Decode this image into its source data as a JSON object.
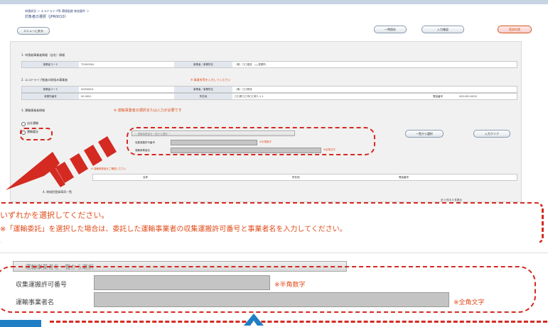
{
  "breadcrumb": {
    "line1": "申請状況 ＞ エコドライブ等 環境配慮 参加要件 ＞",
    "line2": "対象者の選択（JPR0010）"
  },
  "toolbar": {
    "back_label": "メニューに戻る",
    "temp_save_label": "一時保存",
    "check_label": "入力確認",
    "register_label": "登録申請"
  },
  "section1": {
    "heading": "1. 申請者事業者情報（自社）情報",
    "row": [
      {
        "label": "事業者コード",
        "value": "TO000004"
      },
      {
        "label": "事業者／事業所名",
        "value": "（株）〇〇運送　△△営業所"
      }
    ]
  },
  "section2": {
    "heading": "2. エコドライブ推進の取組み事業者",
    "note": "※ 事業所等を入力してください",
    "row1": [
      {
        "label": "事業者コード",
        "value": "00000001"
      },
      {
        "label": "事業者／事業所名",
        "value": "（株）〇〇物流"
      }
    ],
    "row2": [
      {
        "label": "事業所番号",
        "value": "00-0001"
      },
      {
        "label": "所在地",
        "value": "〇〇県〇〇市〇〇町1-1-1"
      },
      {
        "label": "電話番号",
        "value": "000-000-0000"
      }
    ]
  },
  "section3": {
    "heading": "3. 運輸事業者情報",
    "note": "※ 運輸事業者の選択または入力が必要です",
    "radio1": "自社運輸",
    "radio2": "運輸委託",
    "select_placeholder": "－ 運輸事業者を一覧から選択 －",
    "permit_label": "収集運搬許可番号",
    "permit_note": "※半角数字",
    "name_label": "運輸事業者名",
    "name_note": "※全角文字",
    "search_btn": "一覧から選択",
    "clear_btn": "入力クリア"
  },
  "section3b": {
    "note": "※ 運輸事業者をご確認ください",
    "headers": [
      "名称",
      "所在地",
      "電話番号"
    ]
  },
  "section4": {
    "heading": "4. 地域別登録車両一覧",
    "pager": "全 0 件中 0 件表示"
  },
  "callout": {
    "line1": "いずれかを選択してください。",
    "line2": "※「運輸委託」を選択した場合は、委託した運輸事業者の収集運搬許可番号と事業者名を入力してください。"
  },
  "zoom": {
    "select_placeholder": "－ 運輸事業者を一覧から選択 －",
    "permit_label": "収集運搬許可番号",
    "permit_note": "※半角数字",
    "name_label": "運輸事業者名",
    "name_note": "※全角文字"
  },
  "colors": {
    "accent_red": "#d42a22",
    "note_orange": "#e04c1a",
    "link_navy": "#2c3f77"
  }
}
